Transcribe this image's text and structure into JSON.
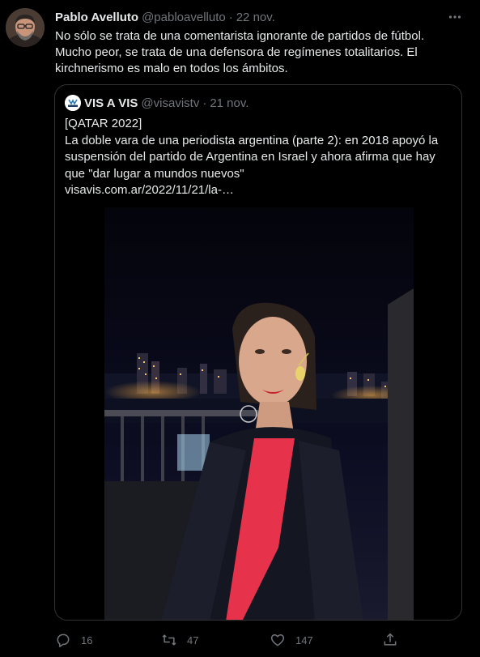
{
  "tweet": {
    "author_name": "Pablo Avelluto",
    "author_handle": "@pabloavelluto",
    "separator": "·",
    "timestamp": "22 nov.",
    "text_lines": [
      "No sólo se trata de una comentarista ignorante de partidos de fútbol.",
      "Mucho peor, se trata de una defensora de regímenes totalitarios. El",
      "kirchnerismo es malo en todos los ámbitos."
    ]
  },
  "quote": {
    "author_name": "VIS A VIS",
    "author_handle": "@visavistv",
    "separator": "·",
    "timestamp": "21 nov.",
    "avatar_logo_text": "VISAVIS",
    "text_lines": [
      "[QATAR 2022]",
      "La doble vara de una periodista argentina (parte 2): en 2018 apoyó la",
      "suspensión del partido de Argentina en Israel y ahora afirma que hay",
      "que \"dar lugar a mundos nuevos\"",
      "visavis.com.ar/2022/11/21/la-…"
    ]
  },
  "actions": {
    "reply_count": "16",
    "retweet_count": "47",
    "like_count": "147"
  },
  "icons": {
    "more": "more-dots-icon",
    "reply": "reply-icon",
    "retweet": "retweet-icon",
    "like": "heart-icon",
    "share": "share-icon"
  },
  "colors": {
    "background": "#000000",
    "text_primary": "#e7e9ea",
    "text_secondary": "#71767b",
    "border": "#2f3336"
  }
}
